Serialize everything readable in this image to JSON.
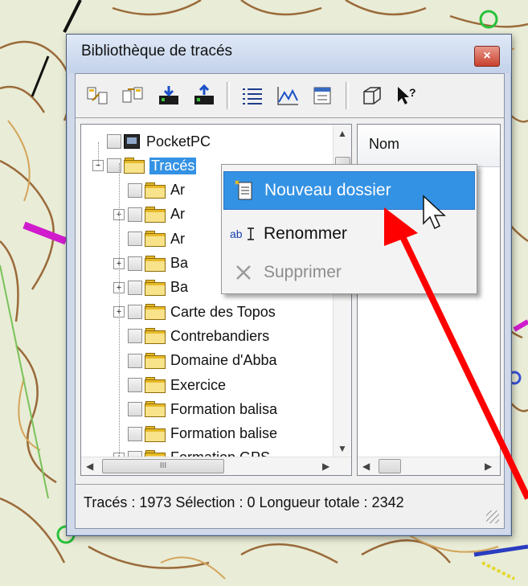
{
  "window": {
    "title": "Bibliothèque de tracés",
    "close_glyph": "×"
  },
  "toolbar": {
    "icons": [
      "import-icon",
      "export-icon",
      "download-icon",
      "upload-icon",
      "list-view-icon",
      "profile-chart-icon",
      "properties-icon",
      "3d-view-icon",
      "help-icon"
    ]
  },
  "tree": {
    "items": [
      {
        "label": "PocketPC",
        "type": "device",
        "expander": ""
      },
      {
        "label": "Tracés",
        "type": "folder",
        "expander": "−",
        "selected": true
      },
      {
        "label": "Ar",
        "type": "folder",
        "expander": ""
      },
      {
        "label": "Ar",
        "type": "folder",
        "expander": "+"
      },
      {
        "label": "Ar",
        "type": "folder",
        "expander": ""
      },
      {
        "label": "Ba",
        "type": "folder",
        "expander": "+"
      },
      {
        "label": "Ba",
        "type": "folder",
        "expander": "+"
      },
      {
        "label": "Carte des Topos",
        "type": "folder",
        "expander": "+"
      },
      {
        "label": "Contrebandiers",
        "type": "folder",
        "expander": ""
      },
      {
        "label": "Domaine d'Abba",
        "type": "folder",
        "expander": ""
      },
      {
        "label": "Exercice",
        "type": "folder",
        "expander": ""
      },
      {
        "label": "Formation balisa",
        "type": "folder",
        "expander": ""
      },
      {
        "label": "Formation balise",
        "type": "folder",
        "expander": ""
      },
      {
        "label": "Formation GPS",
        "type": "folder",
        "expander": "+"
      }
    ]
  },
  "list": {
    "column_header": "Nom"
  },
  "context_menu": {
    "items": [
      {
        "label": "Nouveau dossier",
        "icon": "new-folder-icon",
        "state": "highlighted"
      },
      {
        "label": "Renommer",
        "icon": "rename-icon",
        "state": "normal"
      },
      {
        "label": "Supprimer",
        "icon": "delete-icon",
        "state": "disabled"
      }
    ]
  },
  "statusbar": {
    "text": "Tracés : 1973 Sélection : 0 Longueur totale : 2342"
  },
  "scrollbar": {
    "h_thumb_glyph": "III"
  },
  "colors": {
    "highlight": "#3492e4",
    "annotation_arrow": "#ff0000",
    "folder": "#e7b928"
  }
}
